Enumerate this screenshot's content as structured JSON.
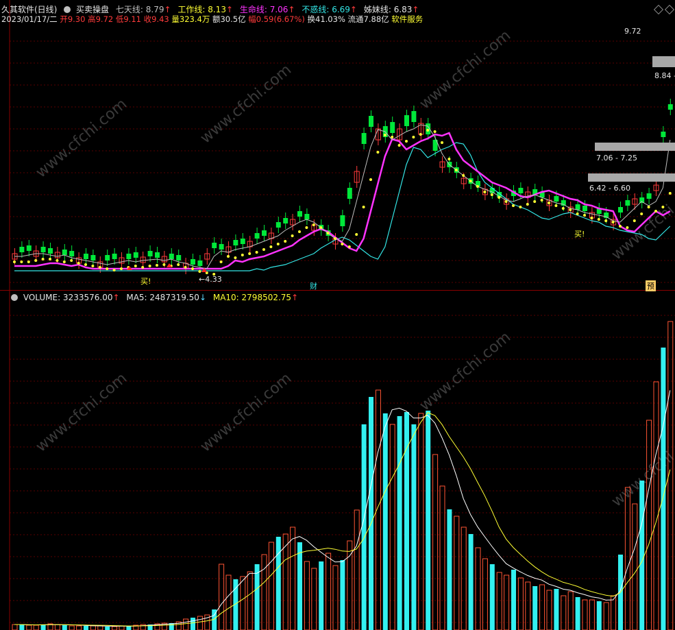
{
  "header": {
    "title": "久其软件(日线)",
    "indicator_name": "买卖操盘",
    "lines": [
      {
        "label": "七天线:",
        "value": "8.79",
        "color": "#bfbfbf"
      },
      {
        "label": "工作线:",
        "value": "8.13",
        "color": "#ffff33"
      },
      {
        "label": "生命线:",
        "value": "7.06",
        "color": "#ff33ff"
      },
      {
        "label": "不惑线:",
        "value": "6.69",
        "color": "#33e6e6"
      },
      {
        "label": "姊妹线:",
        "value": "6.83",
        "color": "#e6e6e6"
      }
    ],
    "info": {
      "date": "2023/01/17/二",
      "open": "开9.30",
      "high": "高9.72",
      "low": "低9.11",
      "close": "收9.43",
      "volume": "量323.4万",
      "amount": "额30.5亿",
      "range": "幅0.59(6.67%)",
      "turnover": "换41.03%",
      "float": "流通7.88亿",
      "service": "软件服务"
    }
  },
  "price_labels": {
    "high_mark": "9.72",
    "level_1": "8.84",
    "level_2a": "7.06",
    "level_2b": "7.25",
    "level_3a": "6.42",
    "level_3b": "6.60",
    "low_mark": "4.33"
  },
  "signals": {
    "buy_1": "买!",
    "buy_2": "买!",
    "finance": "财",
    "forecast": "预"
  },
  "volume_header": {
    "volume_label": "VOLUME: 3233576.00",
    "ma5_label": "MA5: 2487319.50",
    "ma10_label": "MA10: 2798502.75"
  },
  "colors": {
    "up": "#ff3b3b",
    "down": "#00e83a",
    "vol_up": "#ff5533",
    "vol_down": "#33f0f0",
    "seven_line": "#bfbfbf",
    "work_line": "#ffff33",
    "life_line": "#ff33ff",
    "steady_line": "#33e6e6"
  },
  "watermark": "www.cfchi.com"
}
